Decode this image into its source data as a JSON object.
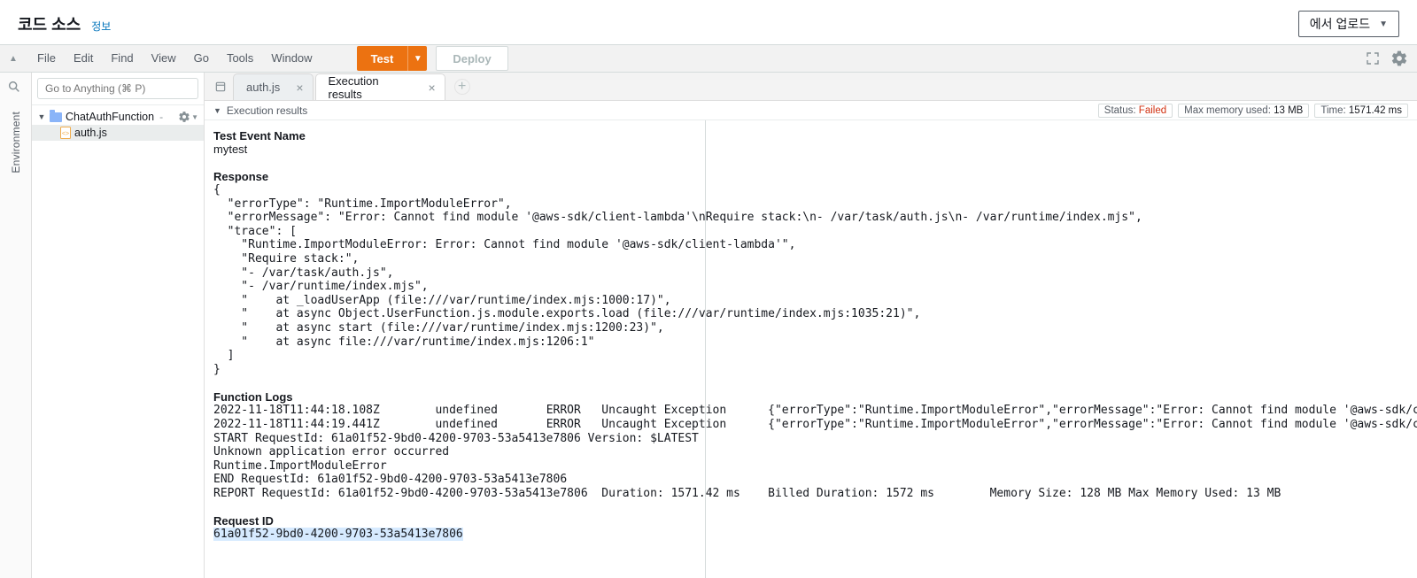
{
  "header": {
    "title": "코드 소스",
    "info": "정보",
    "upload_label": "에서 업로드"
  },
  "menu": {
    "items": [
      "File",
      "Edit",
      "Find",
      "View",
      "Go",
      "Tools",
      "Window"
    ],
    "test": "Test",
    "deploy": "Deploy"
  },
  "sidebar": {
    "search_placeholder": "Go to Anything (⌘ P)",
    "env_label": "Environment",
    "root": "ChatAuthFunction",
    "file": "auth.js"
  },
  "tabs": {
    "file_tab": "auth.js",
    "results_tab": "Execution results"
  },
  "results_header": {
    "title": "Execution results",
    "status_label": "Status:",
    "status_value": "Failed",
    "mem_label": "Max memory used:",
    "mem_value": "13 MB",
    "time_label": "Time:",
    "time_value": "1571.42 ms"
  },
  "results": {
    "test_event_label": "Test Event Name",
    "test_event_name": "mytest",
    "response_label": "Response",
    "response_body": "{\n  \"errorType\": \"Runtime.ImportModuleError\",\n  \"errorMessage\": \"Error: Cannot find module '@aws-sdk/client-lambda'\\nRequire stack:\\n- /var/task/auth.js\\n- /var/runtime/index.mjs\",\n  \"trace\": [\n    \"Runtime.ImportModuleError: Error: Cannot find module '@aws-sdk/client-lambda'\",\n    \"Require stack:\",\n    \"- /var/task/auth.js\",\n    \"- /var/runtime/index.mjs\",\n    \"    at _loadUserApp (file:///var/runtime/index.mjs:1000:17)\",\n    \"    at async Object.UserFunction.js.module.exports.load (file:///var/runtime/index.mjs:1035:21)\",\n    \"    at async start (file:///var/runtime/index.mjs:1200:23)\",\n    \"    at async file:///var/runtime/index.mjs:1206:1\"\n  ]\n}",
    "logs_label": "Function Logs",
    "logs_body": "2022-11-18T11:44:18.108Z\tundefined\tERROR\tUncaught Exception \t{\"errorType\":\"Runtime.ImportModuleError\",\"errorMessage\":\"Error: Cannot find module '@aws-sdk/client-lambda'\\nRequire stac\n2022-11-18T11:44:19.441Z\tundefined\tERROR\tUncaught Exception \t{\"errorType\":\"Runtime.ImportModuleError\",\"errorMessage\":\"Error: Cannot find module '@aws-sdk/client-lambda'\\nRequire stac\nSTART RequestId: 61a01f52-9bd0-4200-9703-53a5413e7806 Version: $LATEST\nUnknown application error occurred\nRuntime.ImportModuleError\nEND RequestId: 61a01f52-9bd0-4200-9703-53a5413e7806\nREPORT RequestId: 61a01f52-9bd0-4200-9703-53a5413e7806\tDuration: 1571.42 ms\tBilled Duration: 1572 ms\tMemory Size: 128 MB Max Memory Used: 13 MB",
    "reqid_label": "Request ID",
    "reqid_value": "61a01f52-9bd0-4200-9703-53a5413e7806"
  }
}
